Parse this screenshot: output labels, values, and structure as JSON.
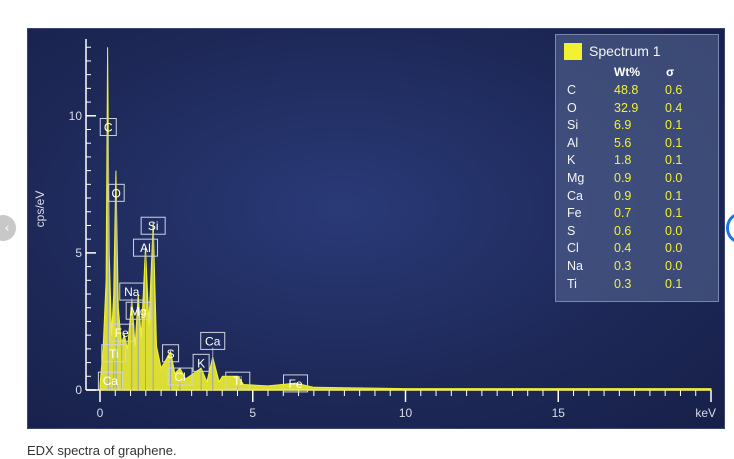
{
  "caption": "EDX spectra of graphene.",
  "chart_data": {
    "type": "line",
    "title": "",
    "xlabel": "keV",
    "ylabel": "cps/eV",
    "xlim": [
      0,
      20
    ],
    "ylim": [
      0,
      12.8
    ],
    "x_ticks": [
      0,
      5,
      10,
      15
    ],
    "y_ticks": [
      0,
      5,
      10
    ],
    "x_tick_labels": [
      "0",
      "5",
      "10",
      "15"
    ],
    "y_tick_labels": [
      "0",
      "5",
      "10"
    ],
    "series": [
      {
        "name": "Spectrum 1",
        "color": "#f2f230",
        "points": [
          [
            0.0,
            0.2
          ],
          [
            0.1,
            1.5
          ],
          [
            0.2,
            4.0
          ],
          [
            0.25,
            12.5
          ],
          [
            0.3,
            5.0
          ],
          [
            0.38,
            2.0
          ],
          [
            0.45,
            3.5
          ],
          [
            0.52,
            8.0
          ],
          [
            0.6,
            3.0
          ],
          [
            0.7,
            1.7
          ],
          [
            0.8,
            2.0
          ],
          [
            0.9,
            1.5
          ],
          [
            1.04,
            3.3
          ],
          [
            1.15,
            1.6
          ],
          [
            1.25,
            3.5
          ],
          [
            1.35,
            1.9
          ],
          [
            1.49,
            5.2
          ],
          [
            1.6,
            2.4
          ],
          [
            1.74,
            6.1
          ],
          [
            1.85,
            1.6
          ],
          [
            2.0,
            0.8
          ],
          [
            2.31,
            1.4
          ],
          [
            2.45,
            0.6
          ],
          [
            2.62,
            0.8
          ],
          [
            2.8,
            0.4
          ],
          [
            3.31,
            0.8
          ],
          [
            3.5,
            0.3
          ],
          [
            3.69,
            1.2
          ],
          [
            3.9,
            0.3
          ],
          [
            4.01,
            0.5
          ],
          [
            4.51,
            0.5
          ],
          [
            4.7,
            0.2
          ],
          [
            5.5,
            0.15
          ],
          [
            6.4,
            0.25
          ],
          [
            7.0,
            0.1
          ],
          [
            10.0,
            0.05
          ],
          [
            20.0,
            0.05
          ]
        ]
      }
    ],
    "peak_labels": [
      {
        "label": "C",
        "x": 0.27,
        "y": 9.9
      },
      {
        "label": "O",
        "x": 0.53,
        "y": 7.5
      },
      {
        "label": "Si",
        "x": 1.74,
        "y": 6.3
      },
      {
        "label": "Al",
        "x": 1.49,
        "y": 5.5
      },
      {
        "label": "Na",
        "x": 1.04,
        "y": 3.9
      },
      {
        "label": "Mg",
        "x": 1.25,
        "y": 3.2
      },
      {
        "label": "Fe",
        "x": 0.71,
        "y": 2.4
      },
      {
        "label": "Ti",
        "x": 0.45,
        "y": 1.65
      },
      {
        "label": "Ca",
        "x": 0.34,
        "y": 0.65
      },
      {
        "label": "S",
        "x": 2.31,
        "y": 1.65
      },
      {
        "label": "Ca",
        "x": 3.69,
        "y": 2.1
      },
      {
        "label": "K",
        "x": 3.31,
        "y": 1.3
      },
      {
        "label": "Cl",
        "x": 2.62,
        "y": 0.8
      },
      {
        "label": "Ti",
        "x": 4.51,
        "y": 0.65
      },
      {
        "label": "Fe",
        "x": 6.4,
        "y": 0.55
      }
    ],
    "legend": {
      "placement": "top-right",
      "series_name": "Spectrum 1",
      "col_wt": "Wt%",
      "col_sigma": "σ",
      "rows": [
        {
          "element": "C",
          "wt": "48.8",
          "sigma": "0.6"
        },
        {
          "element": "O",
          "wt": "32.9",
          "sigma": "0.4"
        },
        {
          "element": "Si",
          "wt": "6.9",
          "sigma": "0.1"
        },
        {
          "element": "Al",
          "wt": "5.6",
          "sigma": "0.1"
        },
        {
          "element": "K",
          "wt": "1.8",
          "sigma": "0.1"
        },
        {
          "element": "Mg",
          "wt": "0.9",
          "sigma": "0.0"
        },
        {
          "element": "Ca",
          "wt": "0.9",
          "sigma": "0.1"
        },
        {
          "element": "Fe",
          "wt": "0.7",
          "sigma": "0.1"
        },
        {
          "element": "S",
          "wt": "0.6",
          "sigma": "0.0"
        },
        {
          "element": "Cl",
          "wt": "0.4",
          "sigma": "0.0"
        },
        {
          "element": "Na",
          "wt": "0.3",
          "sigma": "0.0"
        },
        {
          "element": "Ti",
          "wt": "0.3",
          "sigma": "0.1"
        }
      ]
    }
  }
}
